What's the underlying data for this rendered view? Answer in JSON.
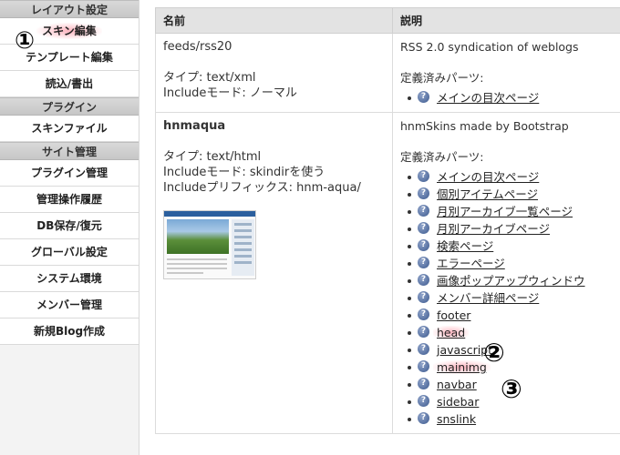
{
  "sidebar": {
    "sections": [
      {
        "heading": "レイアウト設定",
        "items": [
          {
            "label": "スキン編集",
            "highlight": true
          },
          {
            "label": "テンプレート編集"
          },
          {
            "label": "読込/書出"
          }
        ]
      },
      {
        "heading": "プラグイン",
        "items": [
          {
            "label": "スキンファイル"
          }
        ]
      },
      {
        "heading": "サイト管理",
        "items": [
          {
            "label": "プラグイン管理"
          },
          {
            "label": "管理操作履歴"
          },
          {
            "label": "DB保存/復元"
          },
          {
            "label": "グローバル設定"
          },
          {
            "label": "システム環境"
          },
          {
            "label": "メンバー管理"
          },
          {
            "label": "新規Blog作成"
          }
        ]
      }
    ]
  },
  "markers": [
    "①",
    "②",
    "③"
  ],
  "table": {
    "headers": [
      "名前",
      "説明"
    ],
    "rows": [
      {
        "name": "feeds/rss20",
        "type_line": "タイプ: text/xml",
        "include_mode": "Includeモード: ノーマル",
        "description": "RSS 2.0 syndication of weblogs",
        "parts_label": "定義済みパーツ:",
        "parts": [
          "メインの目次ページ"
        ]
      },
      {
        "name": "hnmaqua",
        "type_line": "タイプ: text/html",
        "include_mode": "Includeモード: skindirを使う",
        "include_prefix": "Includeプリフィックス: hnm-aqua/",
        "description": "hnmSkins made by Bootstrap",
        "parts_label": "定義済みパーツ:",
        "parts": [
          "メインの目次ページ",
          "個別アイテムページ",
          "月別アーカイブ一覧ページ",
          "月別アーカイブページ",
          "検索ページ",
          "エラーページ",
          "画像ポップアップウィンドウ",
          "メンバー詳細ページ",
          "footer",
          "head",
          "javascript",
          "mainimg",
          "navbar",
          "sidebar",
          "snslink"
        ],
        "highlighted_parts": [
          "head",
          "mainimg"
        ]
      }
    ]
  },
  "icons": {
    "help": "help-icon",
    "help_glyph": "?"
  },
  "colors": {
    "header_bg": "#e3e3e3",
    "sidebar_heading_bg": "#cfcfcf",
    "highlight": "#ff7a8c",
    "help_icon": "#3d5a8f"
  }
}
